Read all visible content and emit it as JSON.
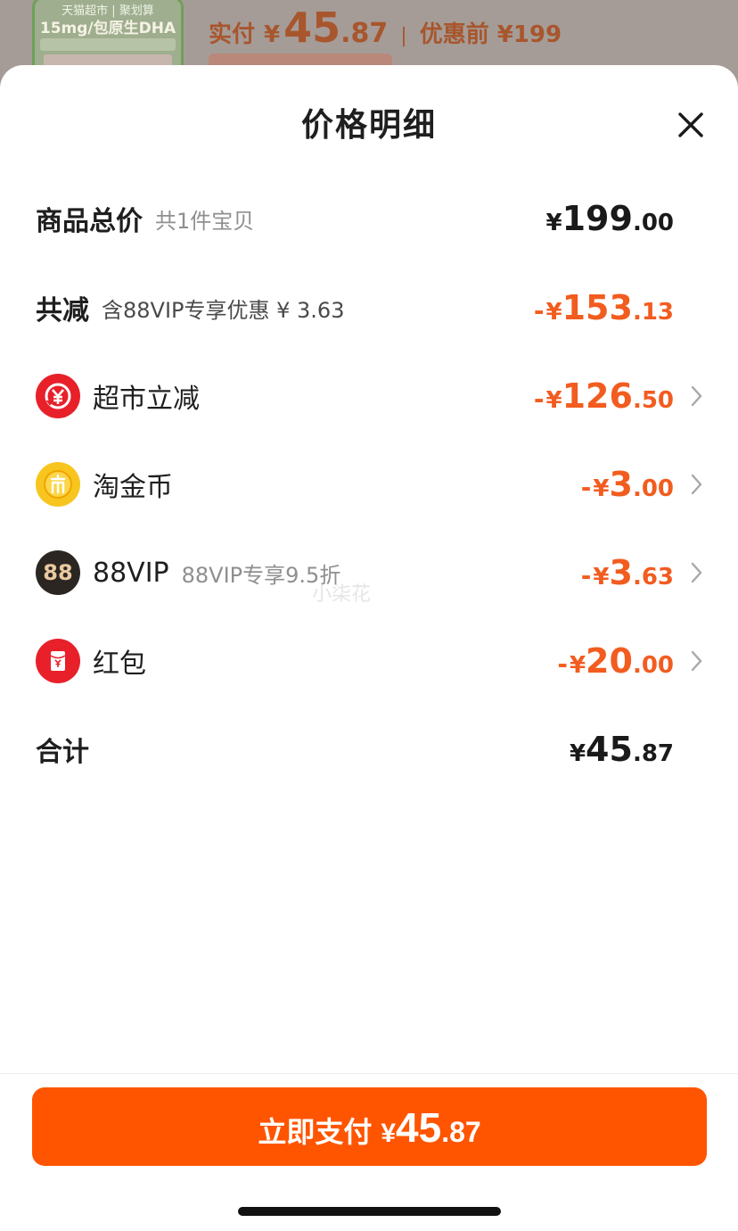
{
  "background": {
    "thumb_line1": "天猫超市 | 聚划算",
    "thumb_line2": "15mg/包原生DHA",
    "actual_label": "实付",
    "actual_currency": "¥",
    "actual_int": "45",
    "actual_dec": ".87",
    "separator": "|",
    "before_discount": "优惠前 ¥199"
  },
  "sheet": {
    "title": "价格明细",
    "close_icon": "close-icon"
  },
  "rows": [
    {
      "label": "商品总价",
      "sub": "共1件宝贝",
      "sign": "",
      "currency": "¥",
      "int": "199",
      "dec": ".00",
      "color": "black"
    },
    {
      "label": "共减",
      "sub": "含88VIP专享优惠 ¥ 3.63",
      "sign": "-",
      "currency": "¥",
      "int": "153",
      "dec": ".13",
      "color": "orange"
    },
    {
      "label": "超市立减",
      "sub": "",
      "sign": "-",
      "currency": "¥",
      "int": "126",
      "dec": ".50",
      "color": "orange",
      "icon": "supermarket-discount-icon"
    },
    {
      "label": "淘金币",
      "sub": "",
      "sign": "-",
      "currency": "¥",
      "int": "3",
      "dec": ".00",
      "color": "orange",
      "icon": "taojinbi-coin-icon"
    },
    {
      "label": "88VIP",
      "sub": "88VIP专享9.5折",
      "sign": "-",
      "currency": "¥",
      "int": "3",
      "dec": ".63",
      "color": "orange",
      "icon": "vip88-icon",
      "icon_text": "88"
    },
    {
      "label": "红包",
      "sub": "",
      "sign": "-",
      "currency": "¥",
      "int": "20",
      "dec": ".00",
      "color": "orange",
      "icon": "red-envelope-icon"
    },
    {
      "label": "合计",
      "sub": "",
      "sign": "",
      "currency": "¥",
      "int": "45",
      "dec": ".87",
      "color": "black"
    }
  ],
  "watermark": "小柒花",
  "pay_button": {
    "label": "立即支付",
    "currency": "¥",
    "int": "45",
    "dec": ".87"
  },
  "colors": {
    "accent": "#ff5500",
    "discount": "#f25c1f",
    "coin": "#f7c51e",
    "red": "#e8202a"
  }
}
